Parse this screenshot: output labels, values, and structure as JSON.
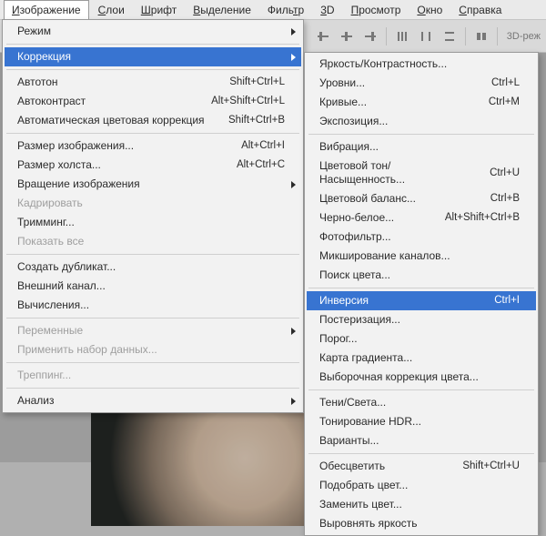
{
  "menubar": {
    "items": [
      {
        "label": "Изображение",
        "mnemonic": 0,
        "active": true
      },
      {
        "label": "Слои",
        "mnemonic": 0
      },
      {
        "label": "Шрифт",
        "mnemonic": 0
      },
      {
        "label": "Выделение",
        "mnemonic": 0
      },
      {
        "label": "Фильтр",
        "mnemonic": 4
      },
      {
        "label": "3D",
        "mnemonic": 0
      },
      {
        "label": "Просмотр",
        "mnemonic": 0
      },
      {
        "label": "Окно",
        "mnemonic": 0
      },
      {
        "label": "Справка",
        "mnemonic": 0
      }
    ]
  },
  "toolbar": {
    "trailing_label": "3D-реж"
  },
  "menu_image": {
    "groups": [
      [
        {
          "label": "Режим",
          "submenu": true
        }
      ],
      [
        {
          "label": "Коррекция",
          "submenu": true,
          "highlight": true
        }
      ],
      [
        {
          "label": "Автотон",
          "shortcut": "Shift+Ctrl+L"
        },
        {
          "label": "Автоконтраст",
          "shortcut": "Alt+Shift+Ctrl+L"
        },
        {
          "label": "Автоматическая цветовая коррекция",
          "shortcut": "Shift+Ctrl+B"
        }
      ],
      [
        {
          "label": "Размер изображения...",
          "shortcut": "Alt+Ctrl+I"
        },
        {
          "label": "Размер холста...",
          "shortcut": "Alt+Ctrl+C"
        },
        {
          "label": "Вращение изображения",
          "submenu": true
        },
        {
          "label": "Кадрировать",
          "disabled": true
        },
        {
          "label": "Тримминг..."
        },
        {
          "label": "Показать все",
          "disabled": true
        }
      ],
      [
        {
          "label": "Создать дубликат..."
        },
        {
          "label": "Внешний канал..."
        },
        {
          "label": "Вычисления..."
        }
      ],
      [
        {
          "label": "Переменные",
          "submenu": true,
          "disabled": true
        },
        {
          "label": "Применить набор данных...",
          "disabled": true
        }
      ],
      [
        {
          "label": "Треппинг...",
          "disabled": true
        }
      ],
      [
        {
          "label": "Анализ",
          "submenu": true
        }
      ]
    ]
  },
  "menu_adjust": {
    "groups": [
      [
        {
          "label": "Яркость/Контрастность..."
        },
        {
          "label": "Уровни...",
          "shortcut": "Ctrl+L"
        },
        {
          "label": "Кривые...",
          "shortcut": "Ctrl+M"
        },
        {
          "label": "Экспозиция..."
        }
      ],
      [
        {
          "label": "Вибрация..."
        },
        {
          "label": "Цветовой тон/Насыщенность...",
          "shortcut": "Ctrl+U"
        },
        {
          "label": "Цветовой баланс...",
          "shortcut": "Ctrl+B"
        },
        {
          "label": "Черно-белое...",
          "shortcut": "Alt+Shift+Ctrl+B"
        },
        {
          "label": "Фотофильтр..."
        },
        {
          "label": "Микширование каналов..."
        },
        {
          "label": "Поиск цвета..."
        }
      ],
      [
        {
          "label": "Инверсия",
          "shortcut": "Ctrl+I",
          "highlight": true
        },
        {
          "label": "Постеризация..."
        },
        {
          "label": "Порог..."
        },
        {
          "label": "Карта градиента..."
        },
        {
          "label": "Выборочная коррекция цвета..."
        }
      ],
      [
        {
          "label": "Тени/Света..."
        },
        {
          "label": "Тонирование HDR..."
        },
        {
          "label": "Варианты..."
        }
      ],
      [
        {
          "label": "Обесцветить",
          "shortcut": "Shift+Ctrl+U"
        },
        {
          "label": "Подобрать цвет..."
        },
        {
          "label": "Заменить цвет..."
        },
        {
          "label": "Выровнять яркость"
        }
      ]
    ]
  }
}
